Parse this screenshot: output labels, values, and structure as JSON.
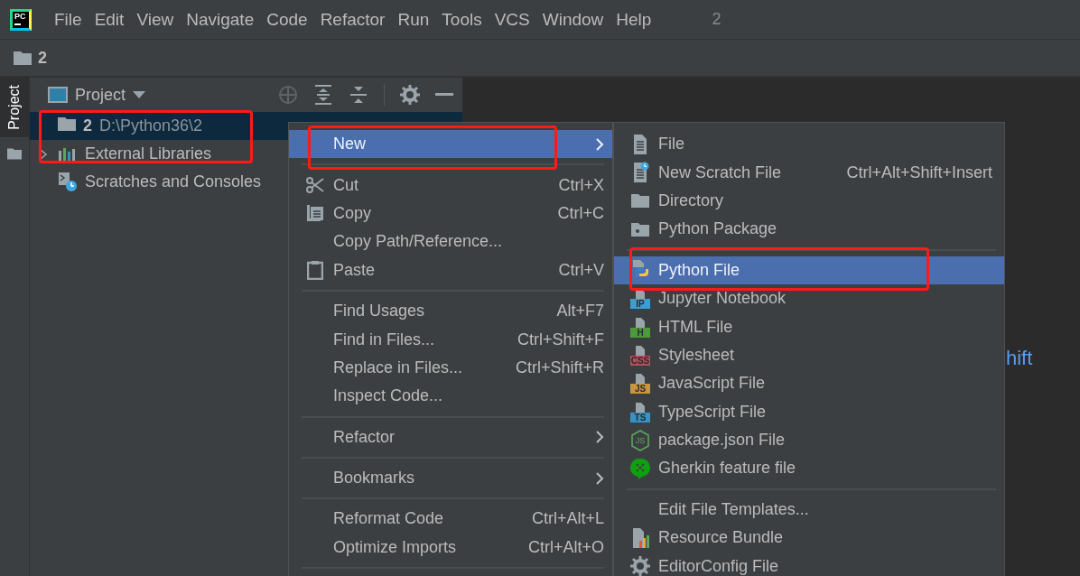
{
  "logo": {
    "text": "PC"
  },
  "menu_bar": [
    {
      "label": "File"
    },
    {
      "label": "Edit"
    },
    {
      "label": "View"
    },
    {
      "label": "Navigate"
    },
    {
      "label": "Code"
    },
    {
      "label": "Refactor"
    },
    {
      "label": "Run"
    },
    {
      "label": "Tools"
    },
    {
      "label": "VCS"
    },
    {
      "label": "Window"
    },
    {
      "label": "Help"
    }
  ],
  "window_title": "2",
  "breadcrumb": "2",
  "tool_strip": [
    {
      "label": "Project",
      "selected": true
    }
  ],
  "project_panel": {
    "title": "Project",
    "tree": [
      {
        "name": "2",
        "path": "D:\\Python36\\2",
        "kind": "folder",
        "selected": true,
        "annotated": true
      },
      {
        "name": "External Libraries",
        "kind": "libraries",
        "expanded": false,
        "selected": false,
        "annotated": false
      },
      {
        "name": "Scratches and Consoles",
        "kind": "scratches",
        "selected": false,
        "annotated": false
      }
    ]
  },
  "editor": {
    "hint": "hift"
  },
  "context_menu": [
    {
      "kind": "plain",
      "label": "New",
      "selected": true,
      "submenu": true,
      "annotated": true
    },
    {
      "kind": "separator"
    },
    {
      "kind": "cut",
      "label": "Cut",
      "shortcut": "Ctrl+X",
      "selected": false
    },
    {
      "kind": "copy",
      "label": "Copy",
      "shortcut": "Ctrl+C",
      "selected": false
    },
    {
      "kind": "plain",
      "label": "Copy Path/Reference...",
      "selected": false
    },
    {
      "kind": "paste",
      "label": "Paste",
      "shortcut": "Ctrl+V",
      "selected": false
    },
    {
      "kind": "separator"
    },
    {
      "kind": "plain",
      "label": "Find Usages",
      "shortcut": "Alt+F7",
      "selected": false
    },
    {
      "kind": "plain",
      "label": "Find in Files...",
      "shortcut": "Ctrl+Shift+F",
      "selected": false
    },
    {
      "kind": "plain",
      "label": "Replace in Files...",
      "shortcut": "Ctrl+Shift+R",
      "selected": false
    },
    {
      "kind": "plain",
      "label": "Inspect Code...",
      "selected": false
    },
    {
      "kind": "separator"
    },
    {
      "kind": "plain",
      "label": "Refactor",
      "submenu": true,
      "selected": false
    },
    {
      "kind": "separator"
    },
    {
      "kind": "plain",
      "label": "Bookmarks",
      "submenu": true,
      "selected": false
    },
    {
      "kind": "separator"
    },
    {
      "kind": "plain",
      "label": "Reformat Code",
      "shortcut": "Ctrl+Alt+L",
      "selected": false
    },
    {
      "kind": "plain",
      "label": "Optimize Imports",
      "shortcut": "Ctrl+Alt+O",
      "selected": false
    },
    {
      "kind": "separator"
    }
  ],
  "new_submenu": [
    {
      "kind": "file",
      "label": "File",
      "selected": false
    },
    {
      "kind": "scratch",
      "label": "New Scratch File",
      "shortcut": "Ctrl+Alt+Shift+Insert",
      "selected": false
    },
    {
      "kind": "folder",
      "label": "Directory",
      "selected": false
    },
    {
      "kind": "package",
      "label": "Python Package",
      "selected": false
    },
    {
      "kind": "separator"
    },
    {
      "kind": "python",
      "label": "Python File",
      "selected": true,
      "annotated": true
    },
    {
      "kind": "badge",
      "badge": "IP",
      "color": "#389fd6",
      "label": "Jupyter Notebook",
      "selected": false
    },
    {
      "kind": "badge",
      "badge": "H",
      "color": "#4e9a3a",
      "label": "HTML File",
      "selected": false
    },
    {
      "kind": "badge",
      "badge": "CSS",
      "color": "#b0505c",
      "label": "Stylesheet",
      "selected": false
    },
    {
      "kind": "badge",
      "badge": "JS",
      "color": "#c8963e",
      "label": "JavaScript File",
      "selected": false
    },
    {
      "kind": "badge",
      "badge": "TS",
      "color": "#3592c4",
      "label": "TypeScript File",
      "selected": false
    },
    {
      "kind": "node",
      "badge": "JS",
      "label": "package.json File",
      "selected": false
    },
    {
      "kind": "gherkin",
      "label": "Gherkin feature file",
      "selected": false
    },
    {
      "kind": "separator"
    },
    {
      "kind": "plain",
      "label": "Edit File Templates...",
      "selected": false
    },
    {
      "kind": "bundle",
      "label": "Resource Bundle",
      "selected": false
    },
    {
      "kind": "config",
      "label": "EditorConfig File",
      "selected": false
    }
  ]
}
